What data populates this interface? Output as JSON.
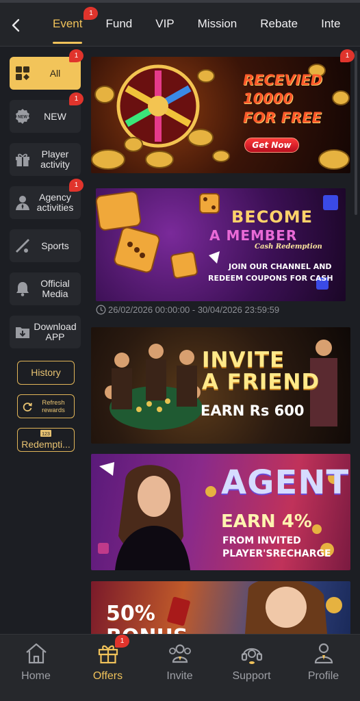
{
  "tabs": [
    {
      "label": "Event",
      "badge": "1"
    },
    {
      "label": "Fund"
    },
    {
      "label": "VIP"
    },
    {
      "label": "Mission"
    },
    {
      "label": "Rebate"
    },
    {
      "label": "Inte"
    }
  ],
  "sidebar": {
    "categories": [
      {
        "label": "All",
        "icon": "grid-icon",
        "badge": "1"
      },
      {
        "label": "NEW",
        "icon": "new-badge-icon",
        "badge": "1"
      },
      {
        "label": "Player activity",
        "icon": "gift-icon"
      },
      {
        "label": "Agency activities",
        "icon": "agent-icon",
        "badge": "1"
      },
      {
        "label": "Sports",
        "icon": "sports-icon"
      },
      {
        "label": "Official Media",
        "icon": "bell-icon"
      },
      {
        "label": "Download APP",
        "icon": "download-icon"
      }
    ],
    "history_label": "History",
    "refresh_label": "Refresh rewards",
    "redemption_label": "Redempti..."
  },
  "banners": {
    "b1": {
      "line1": "RECEVIED",
      "line2": "10000",
      "line3": "FOR FREE",
      "button": "Get Now",
      "badge": "1"
    },
    "b2": {
      "line1": "BECOME",
      "line2": "A MEMBER",
      "line3": "Cash Redemption",
      "line4": "JOIN OUR CHANNEL AND",
      "line5": "REDEEM COUPONS FOR CASH",
      "date": "26/02/2026 00:00:00 - 30/04/2026 23:59:59"
    },
    "b3": {
      "line1": "INVITE",
      "line2": "A FRIEND",
      "line3": "EARN Rs 600"
    },
    "b4": {
      "line1": "AGENT",
      "line2": "EARN 4%",
      "line3": "FROM INVITED",
      "line4": "PLAYER'SRECHARGE"
    },
    "b5": {
      "line1": "50%",
      "line2": "BONUS"
    }
  },
  "bottom_nav": [
    {
      "label": "Home",
      "icon": "home-icon"
    },
    {
      "label": "Offers",
      "icon": "gift-icon",
      "badge": "1"
    },
    {
      "label": "Invite",
      "icon": "people-icon"
    },
    {
      "label": "Support",
      "icon": "headset-icon"
    },
    {
      "label": "Profile",
      "icon": "person-icon"
    }
  ],
  "colors": {
    "accent": "#f0c25a",
    "badge": "#e0342c",
    "background": "#1c1e23"
  }
}
